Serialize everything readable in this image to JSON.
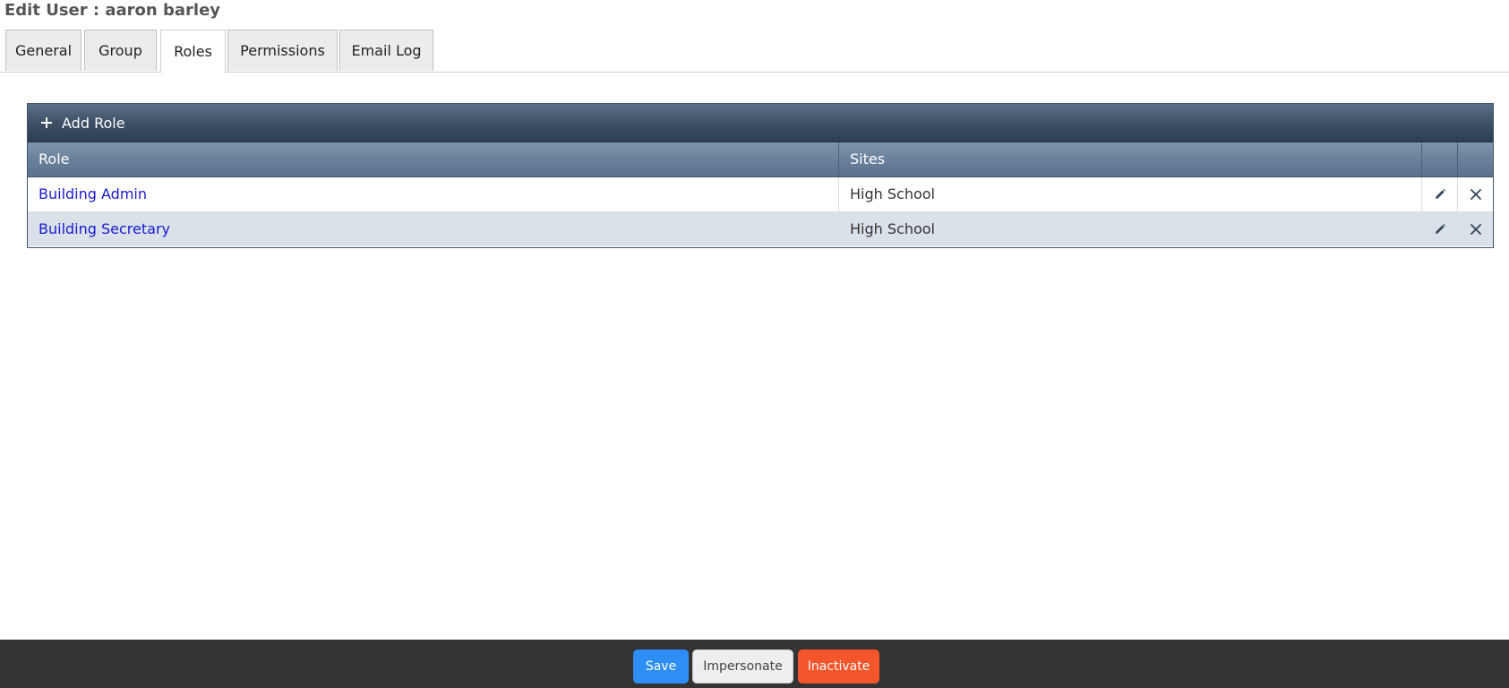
{
  "page": {
    "title": "Edit User : aaron barley"
  },
  "tabs": [
    {
      "label": "General",
      "active": false
    },
    {
      "label": "Group",
      "active": false
    },
    {
      "label": "Roles",
      "active": true
    },
    {
      "label": "Permissions",
      "active": false
    },
    {
      "label": "Email Log",
      "active": false
    }
  ],
  "grid": {
    "toolbar": {
      "add_label": "Add Role",
      "add_icon": "plus-icon"
    },
    "columns": [
      "Role",
      "Sites",
      "",
      ""
    ],
    "rows": [
      {
        "role": "Building Admin",
        "sites": "High School",
        "edit_icon": "pencil-icon",
        "delete_icon": "close-icon"
      },
      {
        "role": "Building Secretary",
        "sites": "High School",
        "edit_icon": "pencil-icon",
        "delete_icon": "close-icon"
      }
    ]
  },
  "footer": {
    "save_label": "Save",
    "impersonate_label": "Impersonate",
    "inactivate_label": "Inactivate"
  },
  "colors": {
    "toolbar": "#3d5066",
    "header": "#6a819b",
    "alt_row": "#dae1e9",
    "link": "#1a1ad6",
    "save": "#2e8ef5",
    "inactivate": "#f4552a",
    "footer_bg": "#333333"
  }
}
